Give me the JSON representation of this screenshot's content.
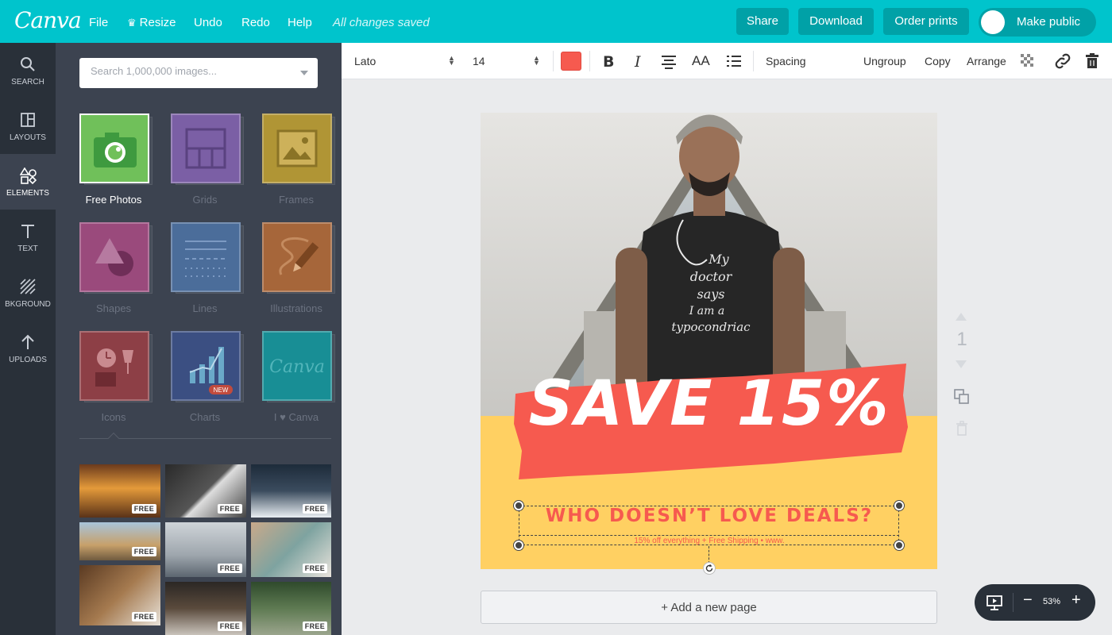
{
  "app": {
    "logo": "Canva"
  },
  "topbar": {
    "menu": [
      "File",
      "Resize",
      "Undo",
      "Redo",
      "Help"
    ],
    "saved_status": "All changes saved",
    "share": "Share",
    "download": "Download",
    "order_prints": "Order prints",
    "make_public": "Make public"
  },
  "rail": [
    {
      "label": "SEARCH",
      "icon": "search-icon"
    },
    {
      "label": "LAYOUTS",
      "icon": "layouts-icon"
    },
    {
      "label": "ELEMENTS",
      "icon": "elements-icon"
    },
    {
      "label": "TEXT",
      "icon": "text-icon"
    },
    {
      "label": "BKGROUND",
      "icon": "background-icon"
    },
    {
      "label": "UPLOADS",
      "icon": "upload-icon"
    }
  ],
  "rail_active": "ELEMENTS",
  "panel": {
    "search_placeholder": "Search 1,000,000 images...",
    "tiles": [
      {
        "label": "Free Photos",
        "color": "#70c05a"
      },
      {
        "label": "Grids",
        "color": "#7b5fa5"
      },
      {
        "label": "Frames",
        "color": "#b09535"
      },
      {
        "label": "Shapes",
        "color": "#9a4a7c"
      },
      {
        "label": "Lines",
        "color": "#4b6d9a"
      },
      {
        "label": "Illustrations",
        "color": "#a6663a"
      },
      {
        "label": "Icons",
        "color": "#8d3f46"
      },
      {
        "label": "Charts",
        "color": "#3b4f82",
        "badge": "NEW"
      },
      {
        "label": "I ♥ Canva",
        "color": "#188e95",
        "logo": "Canva"
      }
    ],
    "photo_badge": "FREE"
  },
  "toolbar": {
    "font": "Lato",
    "size": "14",
    "text_color": "#f65a4f",
    "case_label": "AA",
    "spacing": "Spacing",
    "ungroup": "Ungroup",
    "copy": "Copy",
    "arrange": "Arrange"
  },
  "design": {
    "shirt_text": [
      "My",
      "doctor",
      "says",
      "I am a",
      "typocondriac"
    ],
    "banner": "SAVE 15%",
    "headline": "WHO DOESN’T LOVE DEALS?",
    "subline": "15% off everything + Free Shipping • www."
  },
  "page": {
    "number": "1",
    "add_page": "+ Add a new page"
  },
  "zoom": {
    "value": "53%",
    "minus": "−",
    "plus": "+"
  },
  "colors": {
    "brand": "#00c4cc",
    "accent": "#f65a4f",
    "design_bg": "#ffd062"
  }
}
